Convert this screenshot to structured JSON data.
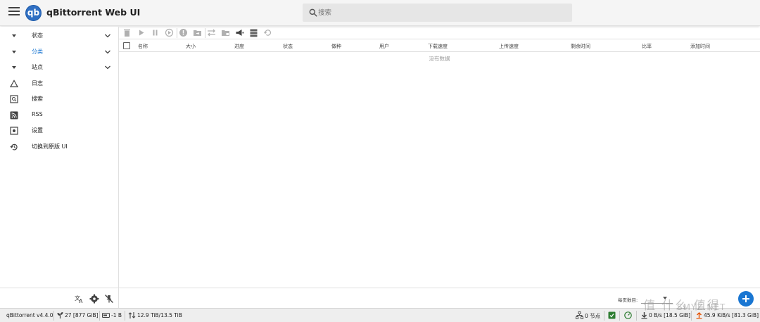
{
  "app": {
    "logo_text": "qb",
    "title": "qBittorrent Web UI"
  },
  "search": {
    "placeholder": "搜索"
  },
  "sidebar": {
    "items": [
      {
        "label": "状态",
        "icon": "chevron-down-small-icon",
        "expandable": true
      },
      {
        "label": "分类",
        "icon": "chevron-down-small-icon",
        "expandable": true,
        "active": true
      },
      {
        "label": "站点",
        "icon": "chevron-down-small-icon",
        "expandable": true
      },
      {
        "label": "日志",
        "icon": "triangle-icon"
      },
      {
        "label": "搜索",
        "icon": "search-box-icon"
      },
      {
        "label": "RSS",
        "icon": "rss-icon"
      },
      {
        "label": "设置",
        "icon": "settings-box-icon"
      },
      {
        "label": "切换到原版 UI",
        "icon": "history-icon"
      }
    ],
    "footer_icons": [
      "translate-icon",
      "gear-icon",
      "pin-off-icon"
    ]
  },
  "toolbar": {
    "icons": [
      "delete-icon",
      "play-icon",
      "pause-icon",
      "force-start-icon",
      "alert-icon",
      "folder-move-icon",
      "folder-label-icon",
      "swap-icon",
      "folder-tag-icon",
      "announce-icon",
      "server-icon",
      "recheck-icon"
    ]
  },
  "table": {
    "columns": [
      "名称",
      "大小",
      "进度",
      "状态",
      "做种",
      "用户",
      "下载速度",
      "上传速度",
      "剩余时间",
      "比率",
      "添加时间"
    ],
    "empty_text": "没有数据"
  },
  "pagination": {
    "per_page_label": "每页数目:"
  },
  "statusbar": {
    "version": "qBittorrent v4.4.0",
    "free_space": "27 [877 GiB]",
    "disk": "-1 B",
    "alltime": "12.9 TiB/13.5 TiB",
    "dht_nodes": "0 节点",
    "download": "0 B/s [18.5 GiB]",
    "upload": "45.9 KiB/s [81.3 GiB]"
  },
  "watermark": {
    "text": "值 什么 值得",
    "site": "SMYZ.NET"
  },
  "colors": {
    "accent": "#1976d2",
    "appbar_bg": "#f5f5f5",
    "status_ok": "#2e7d32"
  }
}
